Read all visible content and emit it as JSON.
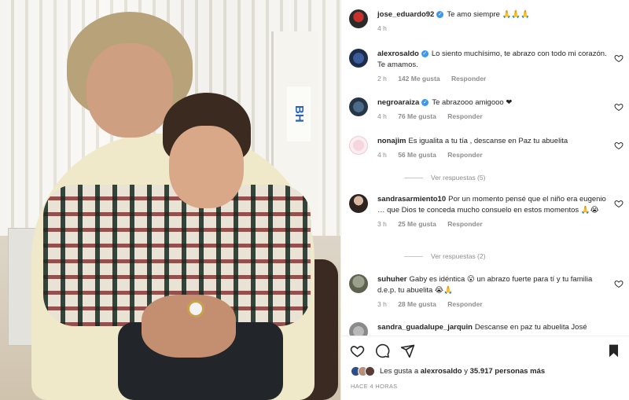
{
  "caption": {
    "username": "jose_eduardo92",
    "text": "Te amo siempre 🙏🙏🙏",
    "time": "4 h"
  },
  "comments": [
    {
      "username": "alexrosaldo",
      "verified": true,
      "text": "Lo siento muchísimo, te abrazo con todo mi corazón. Te amamos.",
      "time": "2 h",
      "likes": "142 Me gusta",
      "reply": "Responder"
    },
    {
      "username": "negroaraiza",
      "verified": true,
      "text": "Te abrazooo amigooo ❤",
      "time": "4 h",
      "likes": "76 Me gusta",
      "reply": "Responder"
    },
    {
      "username": "nonajim",
      "verified": false,
      "text": "Es igualita a tu tía , descanse en Paz tu abuelita",
      "time": "4 h",
      "likes": "56 Me gusta",
      "reply": "Responder",
      "view_replies": "Ver respuestas (5)"
    },
    {
      "username": "sandrasarmiento10",
      "verified": false,
      "text": "Por un momento pensé que el niño era eugenio … que Dios te conceda mucho consuelo en estos momentos 🙏😭",
      "time": "3 h",
      "likes": "25 Me gusta",
      "reply": "Responder",
      "view_replies": "Ver respuestas (2)"
    },
    {
      "username": "suhuher",
      "verified": false,
      "text": "Gaby es idéntica 😮 un abrazo fuerte para tí y tu familia d.e.p. tu abuelita 😭🙏",
      "time": "3 h",
      "likes": "28 Me gusta",
      "reply": "Responder"
    },
    {
      "username": "sandra_guadalupe_jarquin",
      "verified": false,
      "text": "Descanse en paz tu abuelita José"
    }
  ],
  "likes_summary": {
    "prefix": "Les gusta a",
    "user": "alexrosaldo",
    "connector": "y",
    "count": "35.917 personas más"
  },
  "post_time": "HACE 4 HORAS",
  "icons": {
    "heart": "heart-icon",
    "comment": "comment-icon",
    "share": "share-icon",
    "save": "bookmark-icon",
    "verified": "verified-badge-icon"
  },
  "colors": {
    "verified": "#3897f0",
    "meta_gray": "#8e8e8e",
    "like_red": "#ed4956"
  },
  "photo_sign": "BH"
}
